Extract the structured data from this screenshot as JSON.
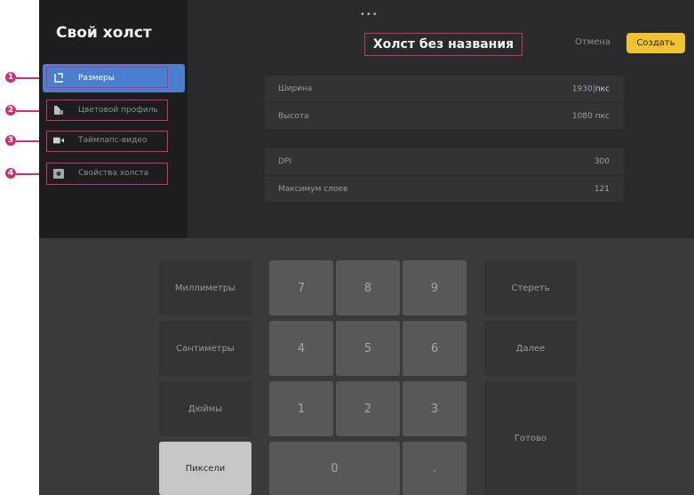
{
  "sidebar": {
    "title": "Свой холст",
    "items": [
      {
        "label": "Размеры",
        "icon": "dimensions-icon",
        "active": true,
        "callout": "1"
      },
      {
        "label": "Цветовой профиль",
        "icon": "color-profile-icon",
        "active": false,
        "callout": "2"
      },
      {
        "label": "Таймлапс-видео",
        "icon": "video-camera-icon",
        "active": false,
        "callout": "3"
      },
      {
        "label": "Свойства холста",
        "icon": "canvas-properties-icon",
        "active": false,
        "callout": "4"
      }
    ]
  },
  "header": {
    "grabber": "•••",
    "title": "Холст без названия",
    "cancel_label": "Отмена",
    "create_label": "Создать"
  },
  "size_group": {
    "width_label": "Ширина",
    "width_value_a": "193",
    "width_value_b": "0",
    "width_unit": "пкс",
    "height_label": "Высота",
    "height_value": "1080 пкс"
  },
  "props_group": {
    "dpi_label": "DPI",
    "dpi_value": "300",
    "layers_label": "Максимум слоев",
    "layers_value": "121"
  },
  "keypad": {
    "units": [
      "Миллиметры",
      "Сантиметры",
      "Дюймы",
      "Пиксели"
    ],
    "digits": [
      "7",
      "8",
      "9",
      "4",
      "5",
      "6",
      "1",
      "2",
      "3",
      "0",
      "."
    ],
    "clear_label": "Стереть",
    "next_label": "Далее",
    "done_label": "Готово"
  },
  "colors": {
    "accent": "#4a7ecf",
    "create_button": "#f1c232",
    "annotation": "#c8307a"
  }
}
